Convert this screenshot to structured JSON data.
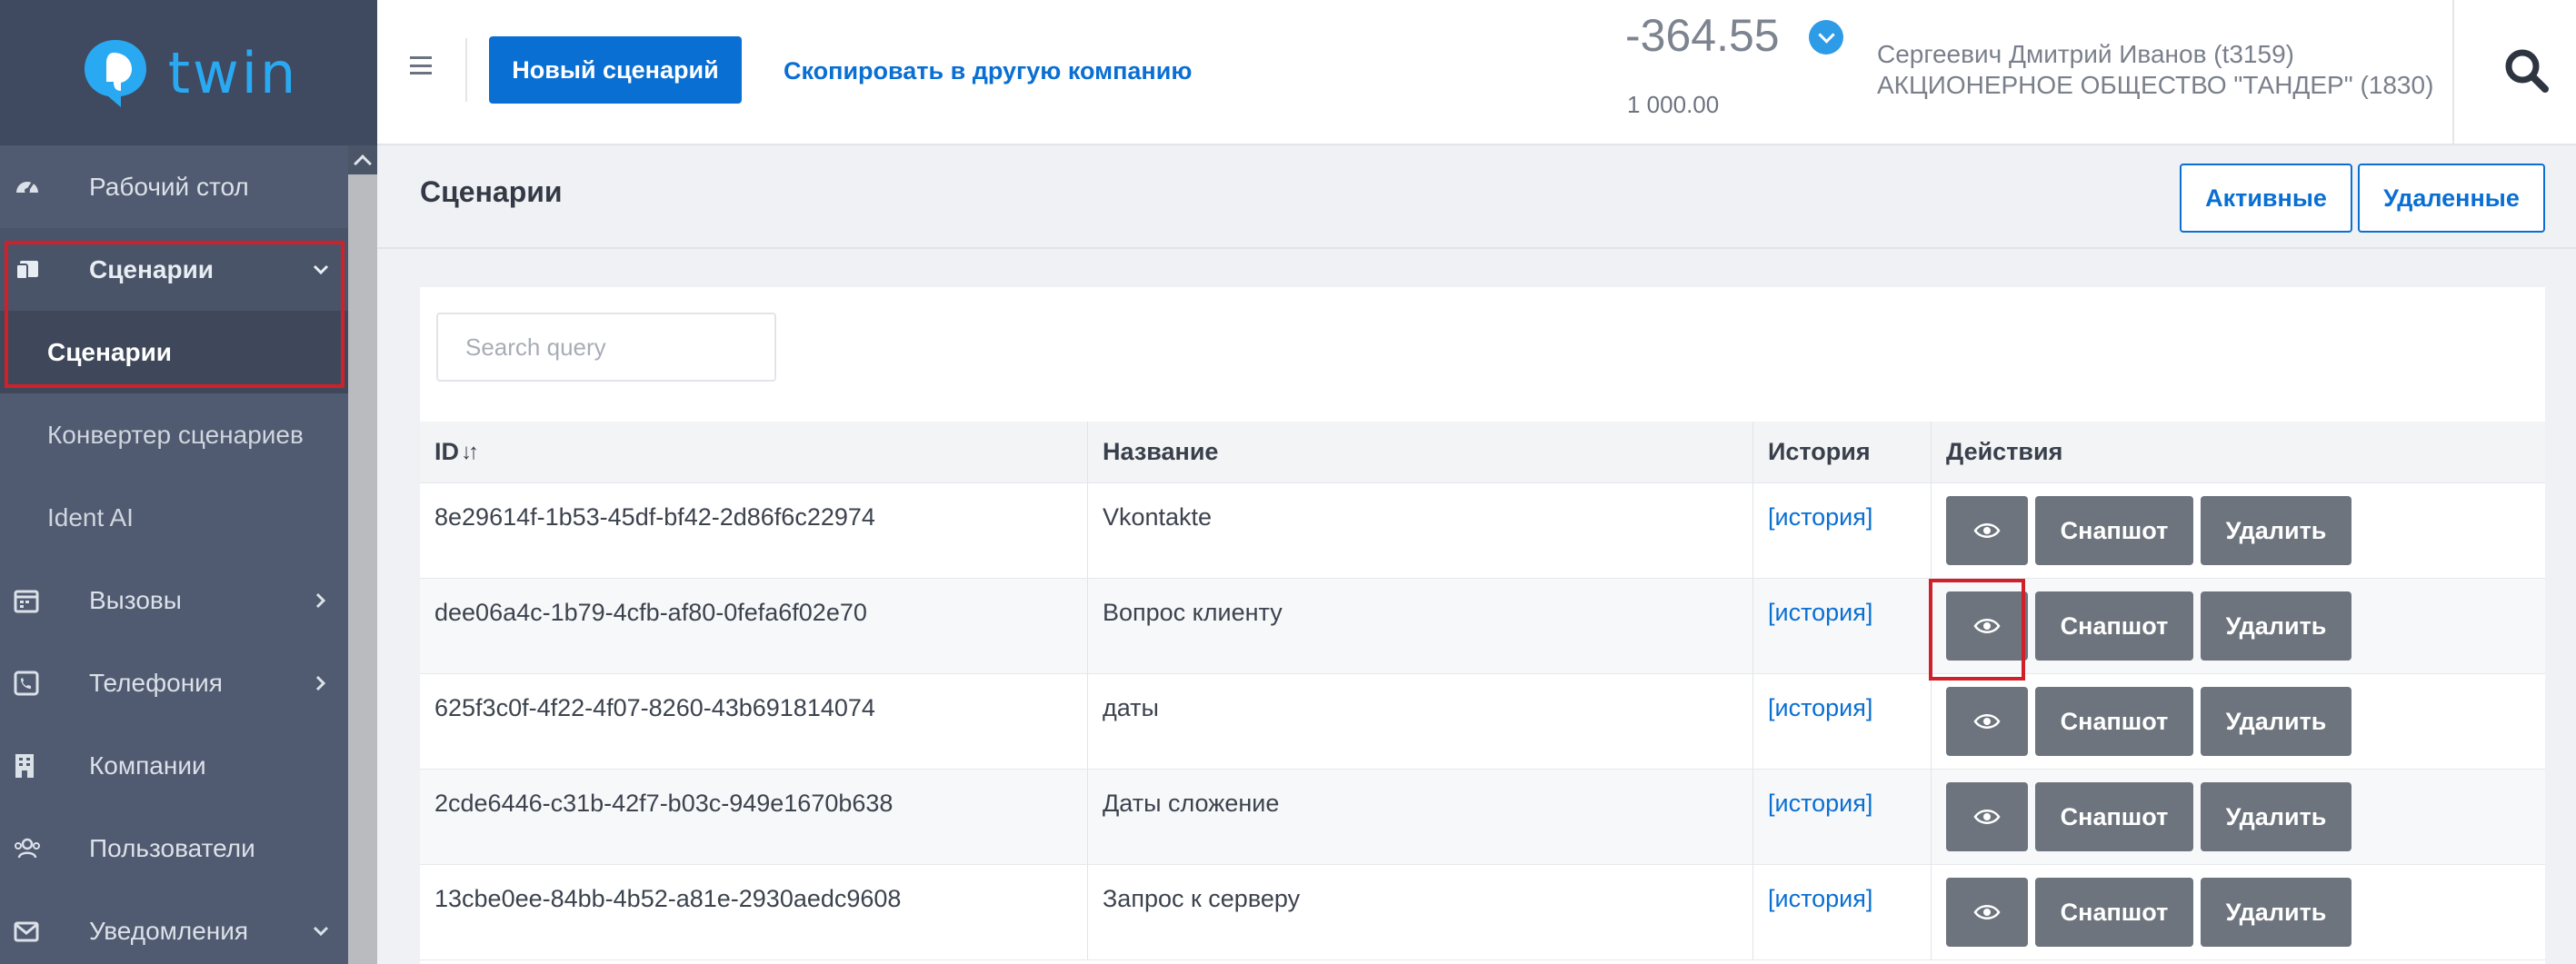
{
  "app": {
    "logo_text": "twin",
    "brand_color": "#2aa9f3",
    "accent_color": "#0a6fd3"
  },
  "sidebar": {
    "items": [
      {
        "label": "Рабочий стол",
        "icon": "dashboard-icon"
      },
      {
        "label": "Сценарии",
        "icon": "scenario-icon",
        "expanded": true
      },
      {
        "label": "Вызовы",
        "icon": "calendar-icon"
      },
      {
        "label": "Телефония",
        "icon": "phone-icon"
      },
      {
        "label": "Компании",
        "icon": "building-icon"
      },
      {
        "label": "Пользователи",
        "icon": "users-icon"
      },
      {
        "label": "Уведомления",
        "icon": "envelope-icon"
      }
    ],
    "subitems": [
      {
        "label": "Сценарии",
        "active": true
      },
      {
        "label": "Конвертер сценариев"
      },
      {
        "label": "Ident AI"
      }
    ]
  },
  "header": {
    "new_scenario_label": "Новый сценарий",
    "copy_link_label": "Скопировать в другую компанию",
    "balance": "-364.55",
    "balance_limit": "1 000.00",
    "user_name": "Сергеевич Дмитрий Иванов (t3159)",
    "user_company": "АКЦИОНЕРНОЕ ОБЩЕСТВО \"ТАНДЕР\" (1830)"
  },
  "page": {
    "title": "Сценарии",
    "tab_active": "Активные",
    "tab_deleted": "Удаленные",
    "search_placeholder": "Search query"
  },
  "table": {
    "headers": {
      "id": "ID",
      "sort_glyph": "↓↑",
      "name": "Название",
      "history": "История",
      "actions": "Действия"
    },
    "rows": [
      {
        "id": "8e29614f-1b53-45df-bf42-2d86f6c22974",
        "name": "Vkontakte",
        "history": "[история]"
      },
      {
        "id": "dee06a4c-1b79-4cfb-af80-0fefa6f02e70",
        "name": "Вопрос клиенту",
        "history": "[история]"
      },
      {
        "id": "625f3c0f-4f22-4f07-8260-43b691814074",
        "name": "даты",
        "history": "[история]"
      },
      {
        "id": "2cde6446-c31b-42f7-b03c-949e1670b638",
        "name": "Даты сложение",
        "history": "[история]"
      },
      {
        "id": "13cbe0ee-84bb-4b52-a81e-2930aedc9608",
        "name": "Запрос к серверу",
        "history": "[история]"
      }
    ],
    "snapshot_label": "Снапшот",
    "delete_label": "Удалить"
  }
}
